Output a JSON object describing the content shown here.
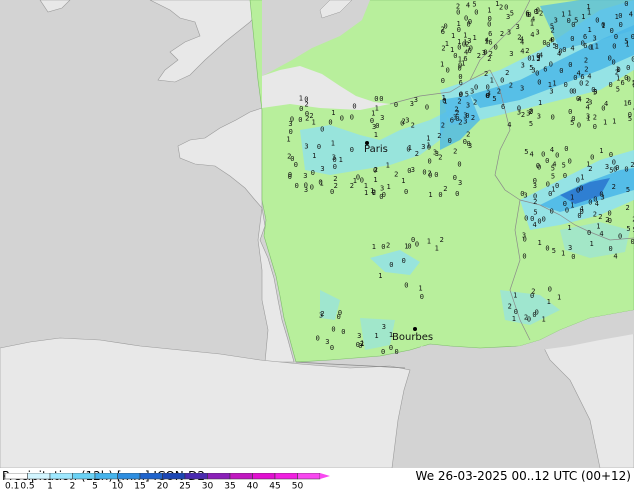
{
  "title": "Precipitation (12h) [mm] ICON-D2",
  "datetime": "We 26-03-2025 00..12 UTC (00+12)",
  "cities": [
    {
      "name": "Paris"
    },
    {
      "name": "Bourbes"
    }
  ],
  "legend": {
    "ticks": [
      "0.1",
      "0.5",
      "1",
      "2",
      "5",
      "10",
      "15",
      "20",
      "25",
      "30",
      "35",
      "40",
      "45",
      "50"
    ],
    "colors": [
      "#ffffff",
      "#d2f5ff",
      "#9ee8ff",
      "#6ad2f5",
      "#46b4ec",
      "#2e8ee0",
      "#2064cc",
      "#1c46b4",
      "#4a2ab0",
      "#8a20b8",
      "#c018c0",
      "#e010d0",
      "#f020e0",
      "#f848f0"
    ]
  },
  "colors": {
    "sea": "#d3d3d3",
    "land_outside": "#e8e8e8",
    "model_land": "#b8ef9c",
    "border": "#8a8a8a",
    "precip_light": "#8ee0f2",
    "precip_mid": "#4cb8e8",
    "precip_heavy": "#2b78cf"
  },
  "value_labels": [
    "0",
    "1",
    "2",
    "3",
    "4",
    "5",
    "6"
  ]
}
